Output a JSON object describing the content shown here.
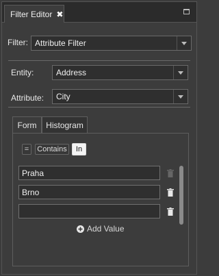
{
  "panel": {
    "tab_title": "Filter Editor",
    "close_symbol": "✖"
  },
  "filter": {
    "label": "Filter:",
    "value": "Attribute Filter"
  },
  "entity": {
    "label": "Entity:",
    "value": "Address"
  },
  "attribute": {
    "label": "Attribute:",
    "value": "City"
  },
  "tabs": [
    {
      "label": "Form",
      "active": true
    },
    {
      "label": "Histogram",
      "active": false
    }
  ],
  "operators": {
    "equals": "=",
    "contains": "Contains",
    "in": "In",
    "selected": "In"
  },
  "values": [
    "Praha",
    "Brno",
    ""
  ],
  "add_value_label": "Add Value",
  "colors": {
    "background": "#3c3c3c",
    "field": "#2f2f2f",
    "border": "#6a6a6a",
    "text": "#e8e8e8"
  }
}
